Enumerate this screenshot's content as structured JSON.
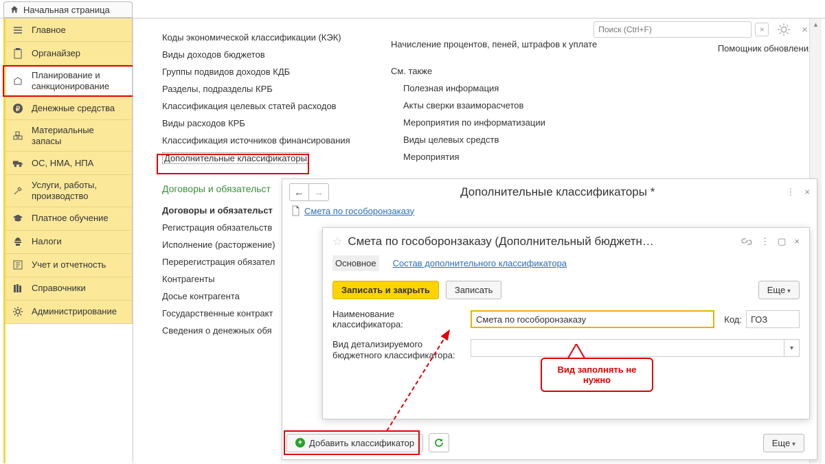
{
  "homeTab": "Начальная страница",
  "sidebar": {
    "items": [
      {
        "label": "Главное"
      },
      {
        "label": "Органайзер"
      },
      {
        "label": "Планирование и санкционирование"
      },
      {
        "label": "Денежные средства"
      },
      {
        "label": "Материальные запасы"
      },
      {
        "label": "ОС, НМА, НПА"
      },
      {
        "label": "Услуги, работы, производство"
      },
      {
        "label": "Платное обучение"
      },
      {
        "label": "Налоги"
      },
      {
        "label": "Учет и отчетность"
      },
      {
        "label": "Справочники"
      },
      {
        "label": "Администрирование"
      }
    ]
  },
  "search": {
    "placeholder": "Поиск (Ctrl+F)"
  },
  "helper": "Помощник обновления",
  "colA": [
    "Коды экономической классификации (КЭК)",
    "Виды доходов бюджетов",
    "Группы подвидов доходов КДБ",
    "Разделы, подразделы КРБ",
    "Классификация целевых статей расходов",
    "Виды расходов КРБ",
    "Классификация источников финансирования",
    "Дополнительные классификаторы"
  ],
  "sectionB": "Договоры и обязательст",
  "colB": [
    "Договоры и обязательст",
    "Регистрация обязательств",
    "Исполнение (расторжение)",
    "Перерегистрация обязател",
    "Контрагенты",
    "Досье контрагента",
    "Государственные контракт",
    "Сведения о денежных обя"
  ],
  "colC_head": "Начисление процентов, пеней, штрафов к уплате",
  "colC_section": "См. также",
  "colC": [
    "Полезная информация",
    "Акты сверки взаиморасчетов",
    "Мероприятия по информатизации",
    "Виды целевых средств",
    "Мероприятия"
  ],
  "win1": {
    "title": "Дополнительные классификаторы *",
    "breadcrumb": "Смета по гособоронзаказу",
    "addBtn": "Добавить классификатор",
    "moreBtn": "Еще"
  },
  "panel": {
    "title": "Смета по гособоронзаказу (Дополнительный бюджетн…",
    "tabMain": "Основное",
    "tabComp": "Состав дополнительного классификатора",
    "saveClose": "Записать и закрыть",
    "save": "Записать",
    "more": "Еще",
    "labelName": "Наименование классификатора:",
    "valueName": "Смета по гособоронзаказу",
    "labelCode": "Код:",
    "valueCode": "ГОЗ",
    "labelKind": "Вид детализируемого бюджетного классификатора:"
  },
  "callout": "Вид заполнять не нужно"
}
